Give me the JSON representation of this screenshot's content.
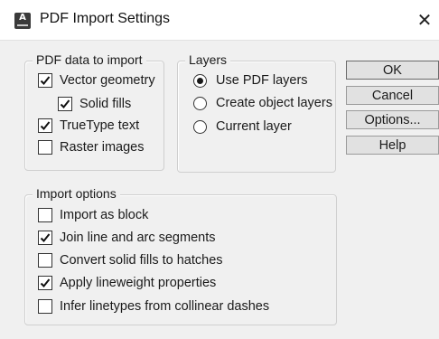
{
  "window": {
    "title": "PDF Import Settings",
    "app_icon": "autocad-icon",
    "close_icon": "close-icon",
    "close_glyph": "✕"
  },
  "pdf_data": {
    "legend": "PDF data to import",
    "items": [
      {
        "label": "Vector geometry",
        "checked": true
      },
      {
        "label": "Solid fills",
        "checked": true
      },
      {
        "label": "TrueType text",
        "checked": true
      },
      {
        "label": "Raster images",
        "checked": false
      }
    ]
  },
  "layers": {
    "legend": "Layers",
    "options": [
      {
        "label": "Use PDF layers",
        "selected": true
      },
      {
        "label": "Create object layers",
        "selected": false
      },
      {
        "label": "Current layer",
        "selected": false
      }
    ]
  },
  "import_options": {
    "legend": "Import options",
    "items": [
      {
        "label": "Import as block",
        "checked": false
      },
      {
        "label": "Join line and arc segments",
        "checked": true
      },
      {
        "label": "Convert solid fills to hatches",
        "checked": false
      },
      {
        "label": "Apply lineweight properties",
        "checked": true
      },
      {
        "label": "Infer linetypes from collinear dashes",
        "checked": false
      }
    ]
  },
  "buttons": {
    "ok": "OK",
    "cancel": "Cancel",
    "options": "Options...",
    "help": "Help"
  }
}
